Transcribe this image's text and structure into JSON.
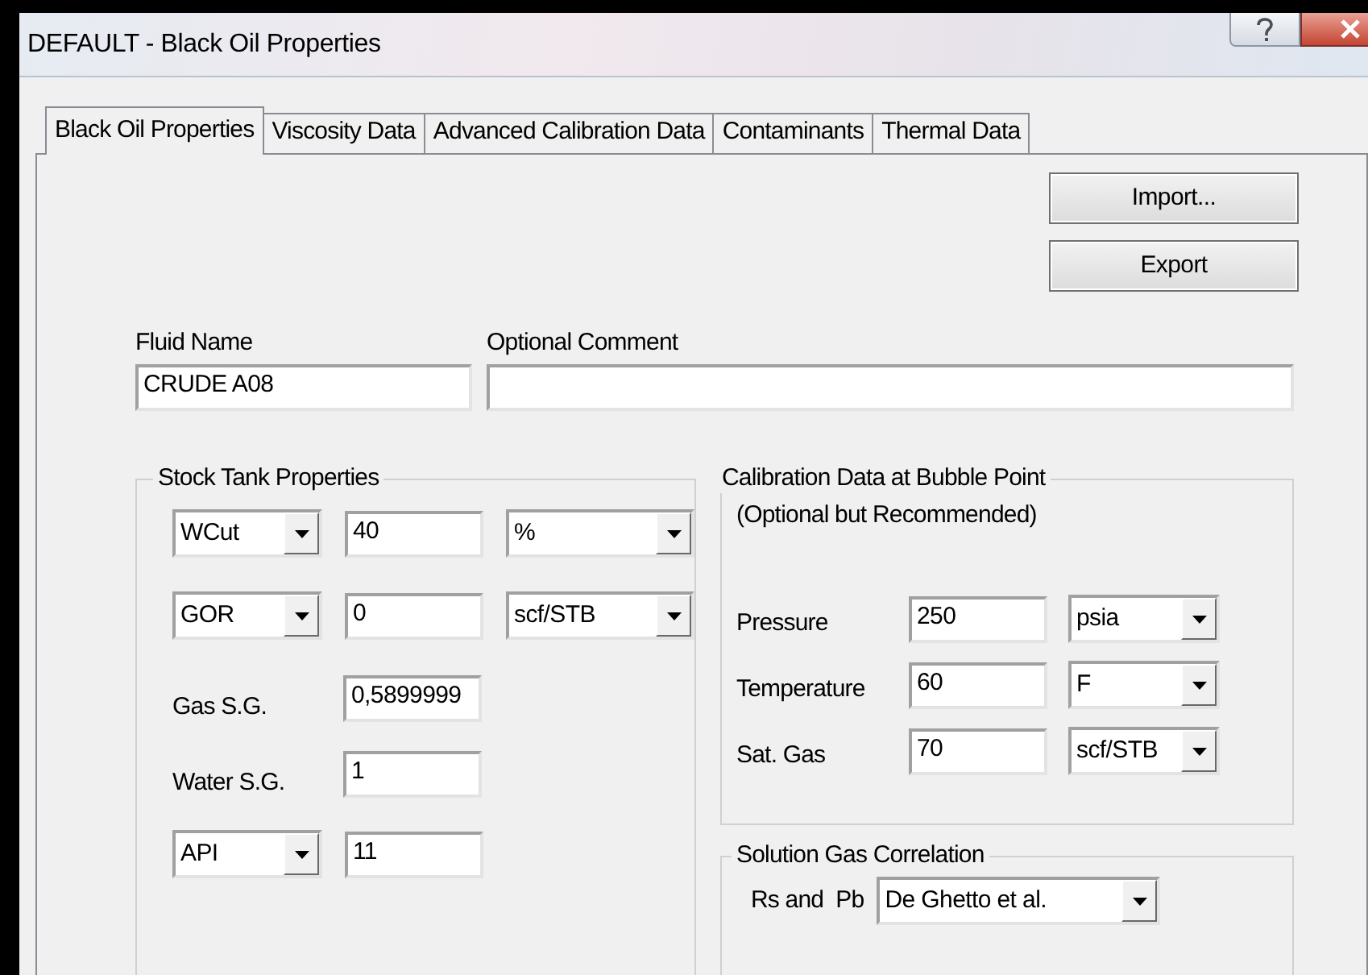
{
  "window": {
    "title": "DEFAULT - Black Oil Properties"
  },
  "tabs": [
    {
      "label": "Black Oil Properties",
      "selected": true
    },
    {
      "label": "Viscosity Data",
      "selected": false
    },
    {
      "label": "Advanced Calibration Data",
      "selected": false
    },
    {
      "label": "Contaminants",
      "selected": false
    },
    {
      "label": "Thermal Data",
      "selected": false
    }
  ],
  "buttons": [
    "Import...",
    "Export"
  ],
  "fluid_name": {
    "label": "Fluid Name",
    "value": "CRUDE A08"
  },
  "optional_comment": {
    "label": "Optional Comment"
  },
  "stock_tank": {
    "title": "Stock Tank Properties",
    "rows": [
      {
        "kind": "combo_input_unit",
        "selector": "WCut",
        "value": "40",
        "unit": "%"
      },
      {
        "kind": "combo_input_unit",
        "selector": "GOR",
        "value": "0",
        "unit": "scf/STB"
      },
      {
        "kind": "label_input",
        "label": "Gas S.G.",
        "value": "0,5899999"
      },
      {
        "kind": "label_input",
        "label": "Water S.G.",
        "value": "1"
      },
      {
        "kind": "combo_input",
        "selector": "API",
        "value": "11"
      }
    ]
  },
  "calibration": {
    "title": "Calibration Data at Bubble Point",
    "note": "(Optional but Recommended)",
    "rows": [
      {
        "label": "Pressure",
        "value": "250",
        "unit": "psia"
      },
      {
        "label": "Temperature",
        "value": "60",
        "unit": "F"
      },
      {
        "label": "Sat. Gas",
        "value": "70",
        "unit": "scf/STB"
      }
    ]
  },
  "solution_gas": {
    "title": "Solution Gas Correlation",
    "rows": [
      {
        "label": "Rs and  Pb",
        "value": "De Ghetto et al."
      }
    ]
  }
}
